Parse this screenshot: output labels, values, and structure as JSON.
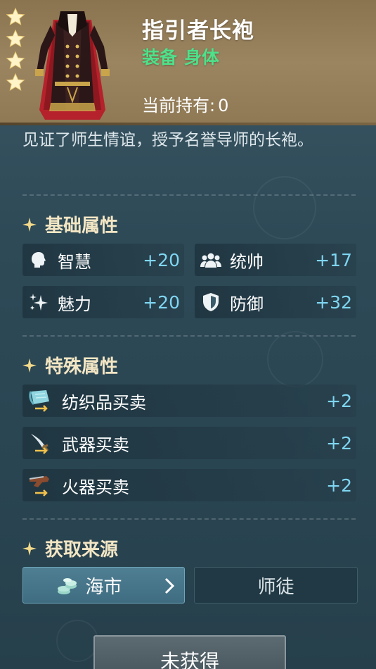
{
  "item": {
    "name": "指引者长袍",
    "tag_type": "装备",
    "tag_slot": "身体",
    "owned_label": "当前持有:",
    "owned_value": "0",
    "stars": 4,
    "description": "见证了师生情谊，授予名誉导师的长袍。"
  },
  "sections": {
    "basic": "基础属性",
    "special": "特殊属性",
    "source": "获取来源"
  },
  "basic_stats": [
    {
      "name": "智慧",
      "value": "+20",
      "icon": "head-icon"
    },
    {
      "name": "统帅",
      "value": "+17",
      "icon": "group-icon"
    },
    {
      "name": "魅力",
      "value": "+20",
      "icon": "sparkle-icon"
    },
    {
      "name": "防御",
      "value": "+32",
      "icon": "shield-icon"
    }
  ],
  "special_stats": [
    {
      "name": "纺织品买卖",
      "value": "+2",
      "icon": "textile-icon"
    },
    {
      "name": "武器买卖",
      "value": "+2",
      "icon": "sword-icon"
    },
    {
      "name": "火器买卖",
      "value": "+2",
      "icon": "musket-icon"
    }
  ],
  "sources": [
    {
      "label": "海市",
      "active": true,
      "icon": "coins-icon"
    },
    {
      "label": "师徒",
      "active": false
    }
  ],
  "status_button": "未获得",
  "colors": {
    "header_gold": "#9b8460",
    "tag_green": "#4ee08a",
    "stat_value": "#7fd6f2",
    "section_title": "#f3e6c4"
  }
}
